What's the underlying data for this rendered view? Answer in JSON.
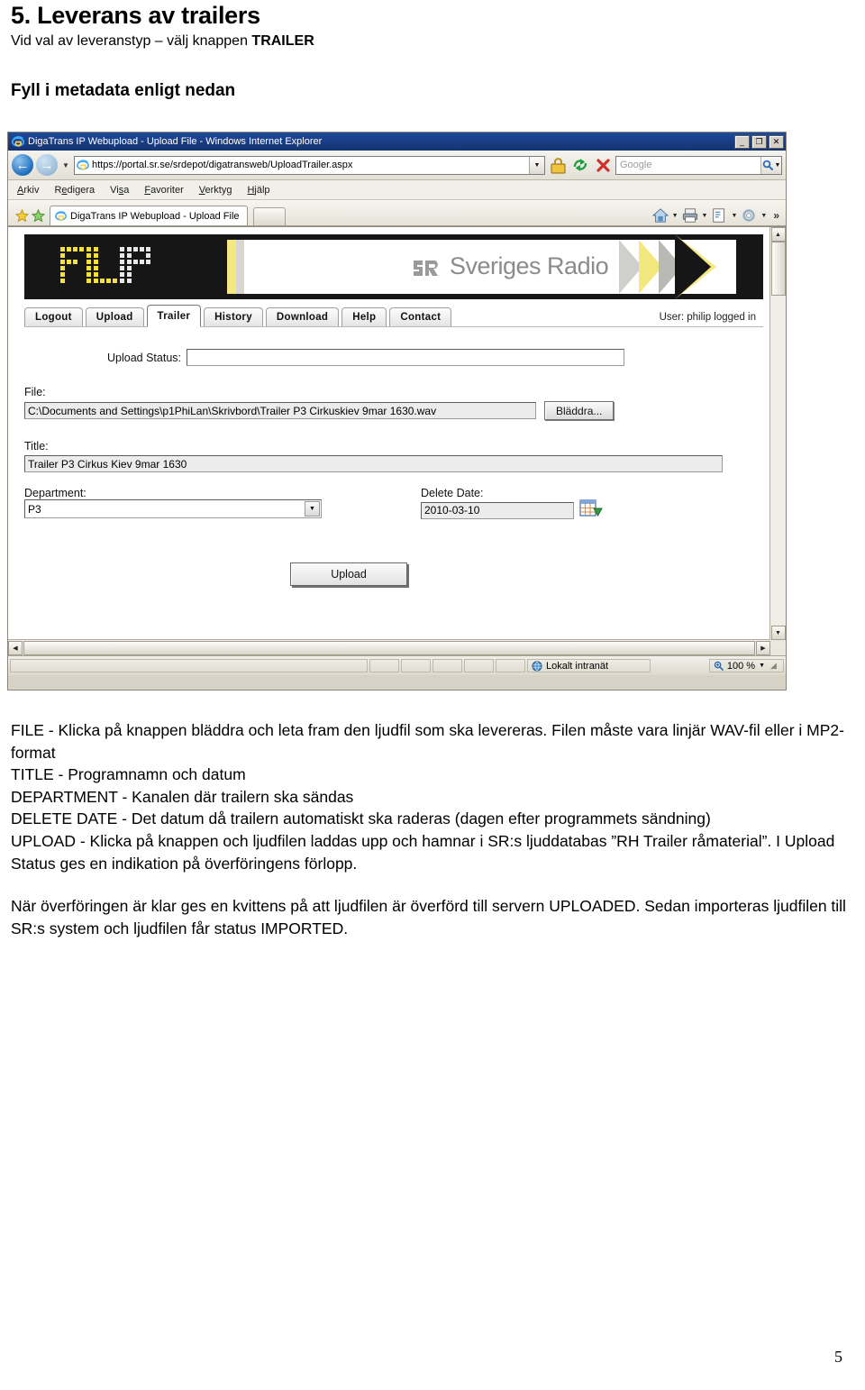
{
  "document": {
    "title": "5. Leverans av trailers",
    "subtitle_pre": "Vid val av leveranstyp – välj knappen ",
    "subtitle_bold": "TRAILER",
    "lead": "Fyll i metadata enligt nedan",
    "page_number": "5",
    "paragraphs": [
      "FILE - Klicka på knappen bläddra och leta fram den ljudfil som ska levereras. Filen måste vara linjär WAV-fil eller i MP2-format",
      "TITLE - Programnamn och datum",
      "DEPARTMENT - Kanalen där trailern ska sändas",
      "DELETE DATE - Det datum då trailern automatiskt ska raderas (dagen efter programmets sändning)",
      "UPLOAD - Klicka på knappen och ljudfilen laddas upp och hamnar i SR:s ljuddatabas ”RH Trailer råmaterial”. I Upload Status ges en indikation på överföringens förlopp."
    ],
    "paragraph_final": "När överföringen är klar ges en kvittens på att ljudfilen är överförd till servern UPLOADED. Sedan importeras ljudfilen till SR:s  system och ljudfilen får status IMPORTED."
  },
  "browser": {
    "window_title": "DigaTrans IP Webupload - Upload File - Windows Internet Explorer",
    "window_buttons": {
      "minimize": "_",
      "maximize": "❐",
      "close": "✕"
    },
    "address": "https://portal.sr.se/srdepot/digatransweb/UploadTrailer.aspx",
    "search_placeholder": "Google",
    "menu": [
      "Arkiv",
      "Redigera",
      "Visa",
      "Favoriter",
      "Verktyg",
      "Hjälp"
    ],
    "menu_mnemonics": [
      "A",
      "R",
      "V",
      "F",
      "V",
      "H"
    ],
    "tab_label": "DigaTrans IP Webupload - Upload File",
    "overflow_chevron": "»",
    "statusbar": {
      "zone": "Lokalt intranät",
      "zoom": "100 %"
    }
  },
  "app": {
    "logo_text": "FILIP",
    "brand_text": "Sveriges Radio",
    "nav_tabs": [
      {
        "label": "Logout",
        "active": false
      },
      {
        "label": "Upload",
        "active": false
      },
      {
        "label": "Trailer",
        "active": true
      },
      {
        "label": "History",
        "active": false
      },
      {
        "label": "Download",
        "active": false
      },
      {
        "label": "Help",
        "active": false
      },
      {
        "label": "Contact",
        "active": false
      }
    ],
    "user_status": "User: philip logged in",
    "form": {
      "upload_status_label": "Upload Status:",
      "upload_status_value": "",
      "file_label": "File:",
      "file_value": "C:\\Documents and Settings\\p1PhiLan\\Skrivbord\\Trailer P3 Cirkuskiev 9mar 1630.wav",
      "browse_button": "Bläddra...",
      "title_label": "Title:",
      "title_value": "Trailer P3 Cirkus Kiev 9mar 1630",
      "department_label": "Department:",
      "department_value": "P3",
      "delete_date_label": "Delete Date:",
      "delete_date_value": "2010-03-10",
      "upload_button": "Upload"
    }
  },
  "colors": {
    "titlebar": "#1b3f86",
    "banner_black": "#161616",
    "accent_yellow": "#f5e03c",
    "brand_gray": "#8b8b8b"
  }
}
